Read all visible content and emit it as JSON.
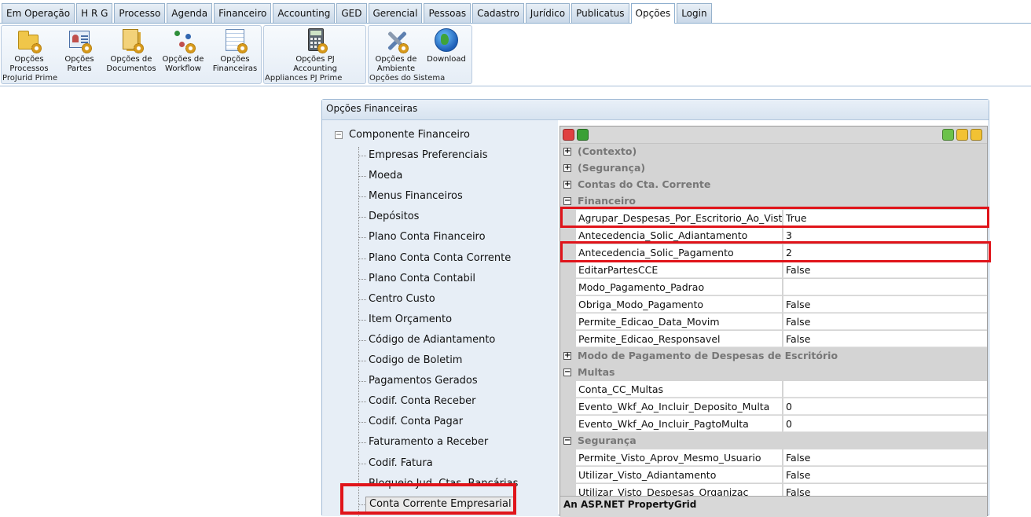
{
  "menu": {
    "tabs": [
      {
        "label": "Em Operação"
      },
      {
        "label": "H R G"
      },
      {
        "label": "Processo"
      },
      {
        "label": "Agenda"
      },
      {
        "label": "Financeiro"
      },
      {
        "label": "Accounting"
      },
      {
        "label": "GED"
      },
      {
        "label": "Gerencial"
      },
      {
        "label": "Pessoas"
      },
      {
        "label": "Cadastro"
      },
      {
        "label": "Jurídico"
      },
      {
        "label": "Publicatus"
      },
      {
        "label": "Opções",
        "active": true
      },
      {
        "label": "Login"
      }
    ]
  },
  "ribbon": {
    "groups": [
      {
        "label": "ProJurid Prime",
        "buttons": [
          {
            "label": "Opções Processos",
            "icon": "folder-gear-icon"
          },
          {
            "label": "Opções Partes",
            "icon": "contact-card-gear-icon"
          },
          {
            "label": "Opções de Documentos",
            "icon": "documents-gear-icon"
          },
          {
            "label": "Opções de Workflow",
            "icon": "workflow-gear-icon"
          },
          {
            "label": "Opções Financeiras",
            "icon": "spreadsheet-gear-icon"
          }
        ]
      },
      {
        "label": "Appliances PJ Prime",
        "buttons": [
          {
            "label": "Opções PJ Accounting",
            "icon": "calculator-gear-icon"
          }
        ]
      },
      {
        "label": "Opções do Sistema",
        "buttons": [
          {
            "label": "Opções de Ambiente",
            "icon": "tools-gear-icon"
          },
          {
            "label": "Download",
            "icon": "globe-icon"
          }
        ]
      }
    ]
  },
  "panel": {
    "title": "Opções Financeiras",
    "tree": {
      "root": "Componente Financeiro",
      "root_toggle": "−",
      "items": [
        "Empresas Preferenciais",
        "Moeda",
        "Menus Financeiros",
        "Depósitos",
        "Plano Conta Financeiro",
        "Plano Conta Conta Corrente",
        "Plano Conta Contabil",
        "Centro Custo",
        "Item Orçamento",
        "Código de Adiantamento",
        "Codigo de Boletim",
        "Pagamentos Gerados",
        "Codif. Conta Receber",
        "Codif. Conta Pagar",
        "Faturamento a Receber",
        "Codif. Fatura",
        "Bloqueio Jud. Ctas. Bancárias",
        "Conta Corrente Empresarial"
      ],
      "selected": "Conta Corrente Empresarial"
    },
    "property_grid": {
      "footer": "An ASP.NET PropertyGrid",
      "rows": [
        {
          "type": "category",
          "label": "(Contexto)",
          "expanded": false
        },
        {
          "type": "category",
          "label": "(Segurança)",
          "expanded": false
        },
        {
          "type": "category",
          "label": "Contas do Cta. Corrente",
          "expanded": false
        },
        {
          "type": "category",
          "label": "Financeiro",
          "expanded": true
        },
        {
          "type": "property",
          "name": "Agrupar_Despesas_Por_Escritorio_Ao_Vistar",
          "value": "True",
          "highlighted": true
        },
        {
          "type": "property",
          "name": "Antecedencia_Solic_Adiantamento",
          "value": "3"
        },
        {
          "type": "property",
          "name": "Antecedencia_Solic_Pagamento",
          "value": "2",
          "highlighted": true
        },
        {
          "type": "property",
          "name": "EditarPartesCCE",
          "value": "False"
        },
        {
          "type": "property",
          "name": "Modo_Pagamento_Padrao",
          "value": ""
        },
        {
          "type": "property",
          "name": "Obriga_Modo_Pagamento",
          "value": "False"
        },
        {
          "type": "property",
          "name": "Permite_Edicao_Data_Movim",
          "value": "False"
        },
        {
          "type": "property",
          "name": "Permite_Edicao_Responsavel",
          "value": "False"
        },
        {
          "type": "category",
          "label": "Modo de Pagamento de Despesas de Escritório",
          "expanded": false
        },
        {
          "type": "category",
          "label": "Multas",
          "expanded": true
        },
        {
          "type": "property",
          "name": "Conta_CC_Multas",
          "value": ""
        },
        {
          "type": "property",
          "name": "Evento_Wkf_Ao_Incluir_Deposito_Multa",
          "value": "0"
        },
        {
          "type": "property",
          "name": "Evento_Wkf_Ao_Incluir_PagtoMulta",
          "value": "0"
        },
        {
          "type": "category",
          "label": "Segurança",
          "expanded": true
        },
        {
          "type": "property",
          "name": "Permite_Visto_Aprov_Mesmo_Usuario",
          "value": "False"
        },
        {
          "type": "property",
          "name": "Utilizar_Visto_Adiantamento",
          "value": "False"
        },
        {
          "type": "property",
          "name": "Utilizar_Visto_Despesas_Organizac",
          "value": "False"
        }
      ],
      "toolbar": [
        {
          "icon": "power-icon",
          "color": "#e04040"
        },
        {
          "icon": "refresh-icon",
          "color": "#3aa035"
        },
        {
          "icon": "help-icon",
          "color": "#6cc24a"
        },
        {
          "icon": "collapse-icon",
          "color": "#f2c233"
        },
        {
          "icon": "expand-icon",
          "color": "#f2c233"
        }
      ]
    }
  },
  "colors": {
    "highlight": "#e0141a",
    "category_bg": "#d4d4d4",
    "tree_bg": "#e7eef6"
  }
}
